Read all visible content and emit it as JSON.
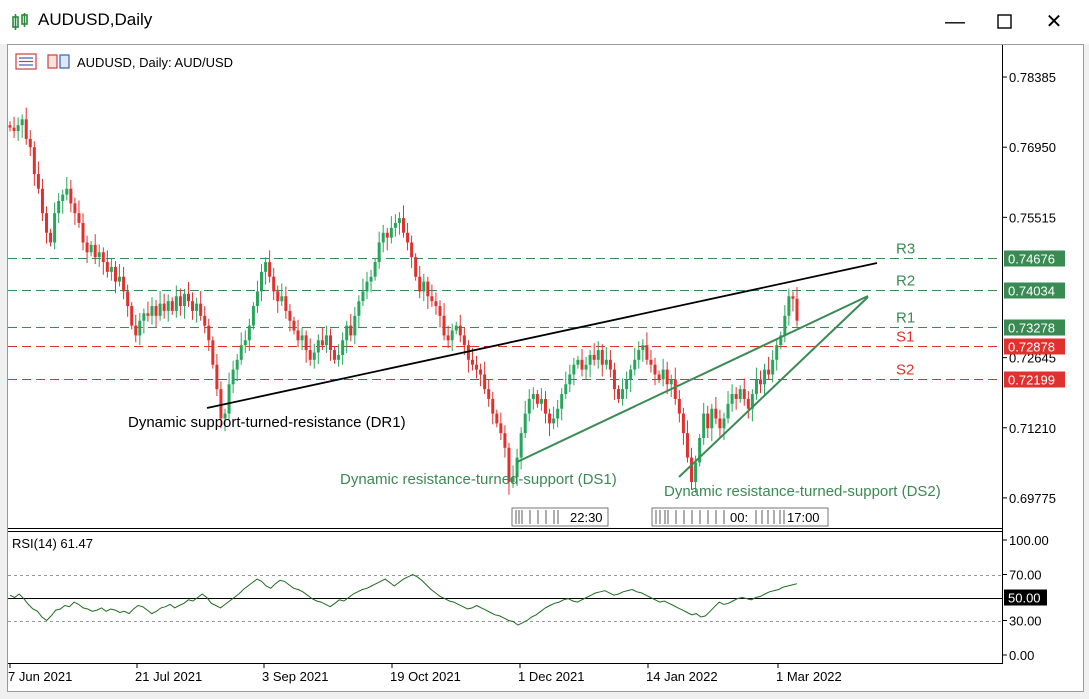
{
  "window": {
    "title": "AUDUSD,Daily",
    "minimize_icon": "minimize-icon",
    "maximize_icon": "maximize-icon",
    "close_icon": "close-icon"
  },
  "chart_header": {
    "text": "AUDUSD, Daily:  AUD/USD"
  },
  "chart_data": [
    {
      "type": "candlestick",
      "y_ticks": [
        "0.78385",
        "0.76950",
        "0.75515",
        "0.72645",
        "0.71210",
        "0.69775"
      ],
      "ylim": [
        0.6918,
        0.7902
      ],
      "x_ticks": [
        "7 Jun 2021",
        "21 Jul 2021",
        "3 Sep 2021",
        "19 Oct 2021",
        "1 Dec 2021",
        "14 Jan 2022",
        "1 Mar 2022"
      ],
      "colors": {
        "up": "#26a65b",
        "down": "#e0312f"
      },
      "levels": [
        {
          "name": "R3",
          "value": "0.74676",
          "color": "#3a8a54"
        },
        {
          "name": "R2",
          "value": "0.74034",
          "color": "#3a8a54"
        },
        {
          "name": "R1",
          "value": "0.73278",
          "color": "#3a8a54"
        },
        {
          "name": "S1",
          "value": "0.72878",
          "color": "#e0312f"
        },
        {
          "name": "S2",
          "value": "0.72199",
          "color": "#e0312f"
        }
      ],
      "trendlines": [
        {
          "label": "Dynamic support-turned-resistance (DR1)",
          "color": "#000000"
        },
        {
          "label": "Dynamic resistance-turned-support (DS1)",
          "color": "#3a8a54"
        },
        {
          "label": "Dynamic resistance-turned-support (DS2)",
          "color": "#3a8a54"
        }
      ],
      "closes": [
        0.7735,
        0.7728,
        0.774,
        0.7752,
        0.7712,
        0.7695,
        0.764,
        0.761,
        0.756,
        0.752,
        0.75,
        0.756,
        0.7585,
        0.7598,
        0.761,
        0.758,
        0.756,
        0.754,
        0.75,
        0.748,
        0.7495,
        0.747,
        0.748,
        0.746,
        0.744,
        0.745,
        0.742,
        0.743,
        0.74,
        0.737,
        0.733,
        0.731,
        0.734,
        0.7355,
        0.735,
        0.737,
        0.735,
        0.7375,
        0.736,
        0.738,
        0.736,
        0.739,
        0.737,
        0.7395,
        0.738,
        0.736,
        0.7375,
        0.735,
        0.733,
        0.73,
        0.725,
        0.72,
        0.714,
        0.715,
        0.721,
        0.724,
        0.726,
        0.729,
        0.73,
        0.733,
        0.737,
        0.74,
        0.744,
        0.746,
        0.743,
        0.74,
        0.738,
        0.739,
        0.736,
        0.734,
        0.732,
        0.73,
        0.731,
        0.728,
        0.726,
        0.7275,
        0.73,
        0.729,
        0.731,
        0.728,
        0.726,
        0.727,
        0.73,
        0.733,
        0.731,
        0.735,
        0.738,
        0.74,
        0.742,
        0.743,
        0.746,
        0.75,
        0.752,
        0.751,
        0.753,
        0.754,
        0.755,
        0.752,
        0.75,
        0.747,
        0.743,
        0.74,
        0.742,
        0.739,
        0.738,
        0.737,
        0.735,
        0.731,
        0.73,
        0.732,
        0.733,
        0.731,
        0.729,
        0.726,
        0.725,
        0.724,
        0.723,
        0.72,
        0.718,
        0.715,
        0.713,
        0.711,
        0.708,
        0.701,
        0.702,
        0.706,
        0.711,
        0.715,
        0.718,
        0.719,
        0.717,
        0.718,
        0.715,
        0.713,
        0.714,
        0.716,
        0.719,
        0.721,
        0.723,
        0.725,
        0.726,
        0.724,
        0.725,
        0.727,
        0.726,
        0.728,
        0.725,
        0.726,
        0.724,
        0.72,
        0.718,
        0.72,
        0.722,
        0.724,
        0.726,
        0.728,
        0.729,
        0.726,
        0.725,
        0.723,
        0.722,
        0.724,
        0.721,
        0.722,
        0.718,
        0.715,
        0.711,
        0.706,
        0.701,
        0.705,
        0.71,
        0.715,
        0.712,
        0.716,
        0.714,
        0.712,
        0.714,
        0.717,
        0.719,
        0.718,
        0.72,
        0.718,
        0.716,
        0.719,
        0.722,
        0.721,
        0.724,
        0.723,
        0.726,
        0.729,
        0.731,
        0.735,
        0.739,
        0.7385,
        0.734
      ]
    },
    {
      "type": "line",
      "title": "RSI(14) 61.47",
      "y_ticks": [
        "100.00",
        "70.00",
        "50.00",
        "30.00",
        "0.00"
      ],
      "ylim": [
        0,
        100
      ],
      "reference_levels": [
        70,
        50,
        30
      ],
      "color": "#1f6b1f",
      "values": [
        52,
        50,
        53,
        49,
        44,
        40,
        38,
        33,
        30,
        34,
        39,
        40,
        43,
        42,
        46,
        44,
        41,
        40,
        38,
        39,
        41,
        38,
        40,
        39,
        37,
        38,
        36,
        40,
        43,
        42,
        39,
        36,
        38,
        41,
        42,
        44,
        41,
        43,
        45,
        48,
        47,
        50,
        53,
        50,
        45,
        43,
        41,
        44,
        47,
        50,
        53,
        57,
        60,
        63,
        66,
        64,
        60,
        58,
        62,
        65,
        64,
        61,
        58,
        57,
        55,
        52,
        49,
        47,
        46,
        44,
        42,
        45,
        48,
        47,
        50,
        53,
        55,
        57,
        58,
        60,
        62,
        64,
        66,
        63,
        60,
        63,
        66,
        68,
        70,
        68,
        65,
        61,
        57,
        54,
        51,
        49,
        47,
        46,
        44,
        42,
        40,
        41,
        43,
        41,
        39,
        37,
        35,
        34,
        32,
        30,
        29,
        26,
        28,
        30,
        33,
        35,
        38,
        41,
        43,
        45,
        46,
        48,
        49,
        47,
        46,
        48,
        50,
        52,
        54,
        55,
        56,
        54,
        52,
        53,
        55,
        56,
        57,
        55,
        54,
        52,
        50,
        48,
        46,
        47,
        45,
        43,
        41,
        39,
        37,
        35,
        36,
        33,
        34,
        38,
        42,
        46,
        44,
        45,
        47,
        49,
        50,
        49,
        48,
        50,
        51,
        53,
        55,
        56,
        57,
        59,
        60,
        61,
        62
      ]
    }
  ],
  "annotations": {
    "dr1": "Dynamic support-turned-resistance (DR1)",
    "ds1": "Dynamic resistance-turned-support (DS1)",
    "ds2": "Dynamic resistance-turned-support (DS2)"
  },
  "time_labels": {
    "a": "22:30",
    "b": "00:",
    "c": "17:00"
  }
}
